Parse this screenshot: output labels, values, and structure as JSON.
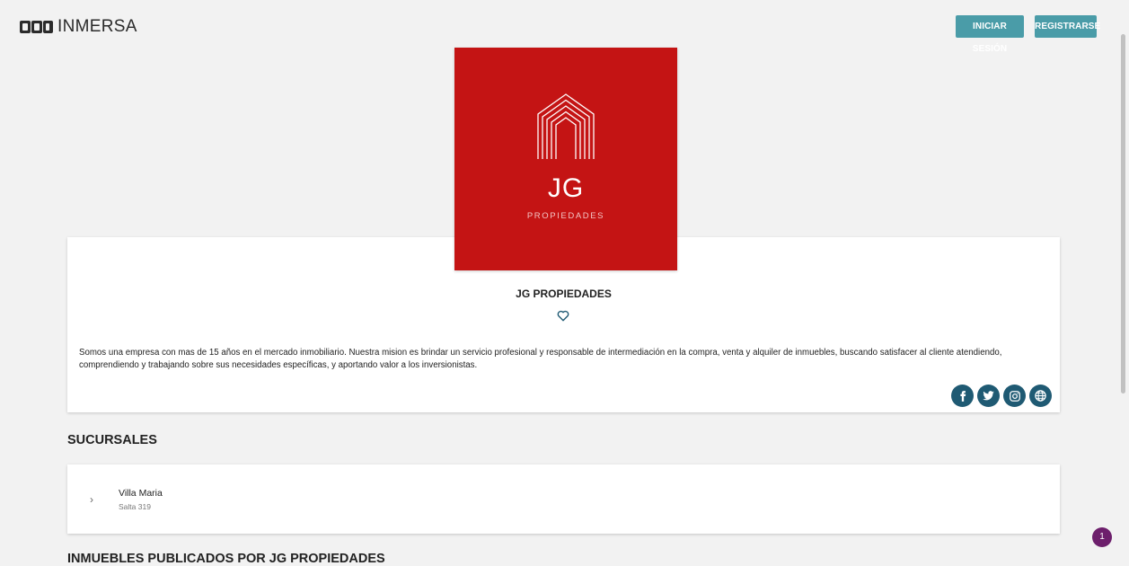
{
  "header": {
    "brand": "INMERSA",
    "login_label": "INICIAR SESIÓN",
    "register_label": "REGISTRARSE"
  },
  "profile": {
    "logo_initials": "JG",
    "logo_subtitle": "PROPIEDADES",
    "name": "JG PROPIEDADES",
    "description": "Somos una empresa con mas de 15 años en el mercado inmobiliario. Nuestra mision es brindar un servicio profesional y responsable de intermediación en la compra, venta y alquiler de inmuebles, buscando satisfacer al cliente atendiendo, comprendiendo y trabajando sobre sus necesidades específicas, y aportando valor a los inversionistas.",
    "socials": [
      "facebook-icon",
      "twitter-icon",
      "instagram-icon",
      "globe-icon"
    ]
  },
  "branches": {
    "title": "SUCURSALES",
    "items": [
      {
        "name": "Villa Maria",
        "address": "Salta 319"
      }
    ]
  },
  "listings": {
    "title": "INMUEBLES PUBLICADOS POR JG PROPIEDADES"
  },
  "notification": {
    "count": "1"
  },
  "colors": {
    "accent": "#4a9ca8",
    "logo_bg": "#c41414",
    "social_bg": "#1f5a73",
    "badge": "#6d1f6c"
  }
}
